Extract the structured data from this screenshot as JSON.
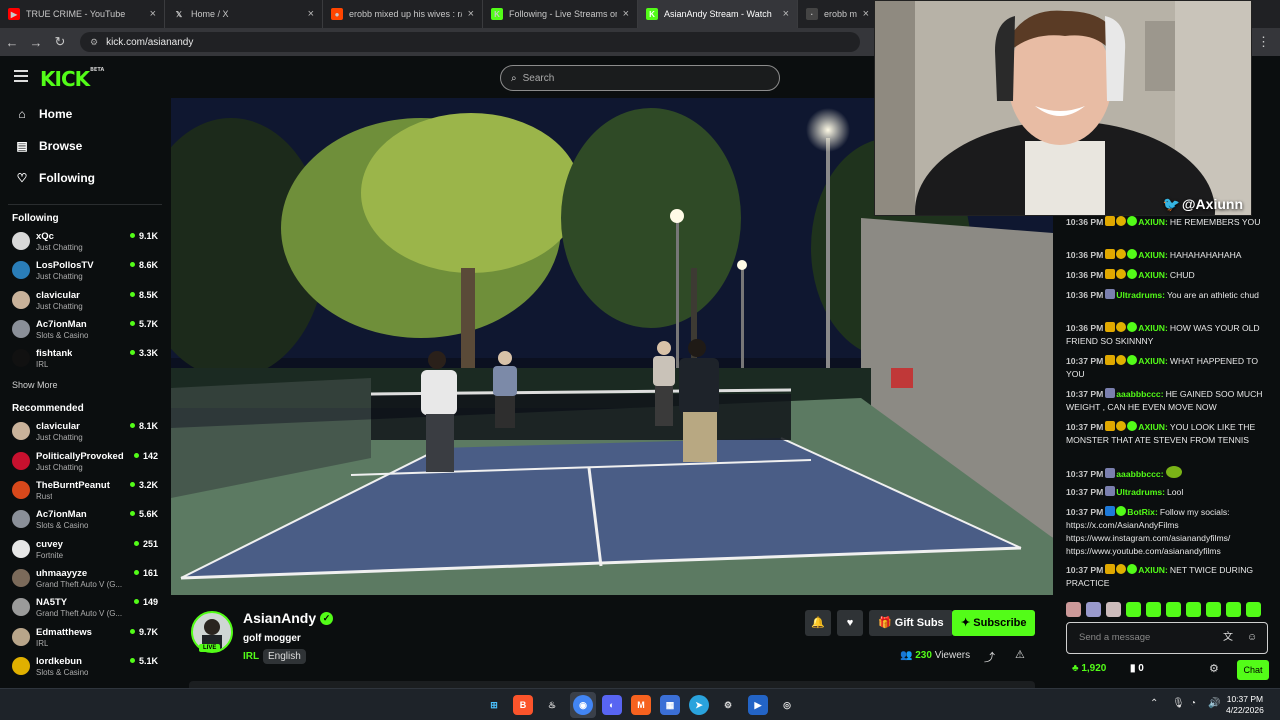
{
  "browser": {
    "tabs": [
      {
        "title": "TRUE CRIME - YouTube",
        "icon": "youtube-icon",
        "color": "#ff0000",
        "glyph": "▶",
        "active": false
      },
      {
        "title": "Home / X",
        "icon": "x-icon",
        "color": "#202124",
        "glyph": "𝕏",
        "active": false
      },
      {
        "title": "erobb mixed up his wives : r/Liv",
        "icon": "reddit-icon",
        "color": "#ff4500",
        "glyph": "●",
        "active": false
      },
      {
        "title": "Following - Live Streams on Kic",
        "icon": "kick-icon",
        "color": "#53fc18",
        "glyph": "K",
        "active": false
      },
      {
        "title": "AsianAndy Stream - Watch",
        "icon": "kick-icon",
        "color": "#53fc18",
        "glyph": "K",
        "active": true
      },
      {
        "title": "erobb mixed u",
        "icon": "page-icon",
        "color": "#444",
        "glyph": "·",
        "active": false
      }
    ],
    "url": "kick.com/asianandy"
  },
  "kick": {
    "logo": "KICK",
    "logo_tag": "BETA",
    "search_placeholder": "Search"
  },
  "sidebar": {
    "nav": [
      {
        "label": "Home",
        "icon": "home-icon",
        "glyph": "⌂"
      },
      {
        "label": "Browse",
        "icon": "browse-icon",
        "glyph": "▤"
      },
      {
        "label": "Following",
        "icon": "heart-icon",
        "glyph": "♡"
      }
    ],
    "following_title": "Following",
    "following": [
      {
        "name": "xQc",
        "category": "Just Chatting",
        "viewers": "9.1K",
        "avatar": "#d8d8d8"
      },
      {
        "name": "LosPollosTV",
        "category": "Just Chatting",
        "viewers": "8.6K",
        "avatar": "#2a7db8"
      },
      {
        "name": "clavicular",
        "category": "Just Chatting",
        "viewers": "8.5K",
        "avatar": "#c9b29a"
      },
      {
        "name": "Ac7ionMan",
        "category": "Slots & Casino",
        "viewers": "5.7K",
        "avatar": "#8a8f98"
      },
      {
        "name": "fishtank",
        "category": "IRL",
        "viewers": "3.3K",
        "avatar": "#111111"
      }
    ],
    "show_more": "Show More",
    "recommended_title": "Recommended",
    "recommended": [
      {
        "name": "clavicular",
        "category": "Just Chatting",
        "viewers": "8.1K",
        "avatar": "#c9b29a"
      },
      {
        "name": "PoliticallyProvoked",
        "category": "Just Chatting",
        "viewers": "142",
        "avatar": "#c8102e"
      },
      {
        "name": "TheBurntPeanut",
        "category": "Rust",
        "viewers": "3.2K",
        "avatar": "#d8481b"
      },
      {
        "name": "Ac7ionMan",
        "category": "Slots & Casino",
        "viewers": "5.6K",
        "avatar": "#8a8f98"
      },
      {
        "name": "cuvey",
        "category": "Fortnite",
        "viewers": "251",
        "avatar": "#e6e6e6"
      },
      {
        "name": "uhmaayyze",
        "category": "Grand Theft Auto V (G...",
        "viewers": "161",
        "avatar": "#7b6a5a"
      },
      {
        "name": "NA5TY",
        "category": "Grand Theft Auto V (G...",
        "viewers": "149",
        "avatar": "#9a9a9a"
      },
      {
        "name": "Edmatthews",
        "category": "IRL",
        "viewers": "9.7K",
        "avatar": "#b8a58a"
      },
      {
        "name": "lordkebun",
        "category": "Slots & Casino",
        "viewers": "5.1K",
        "avatar": "#e0b000"
      }
    ]
  },
  "webcam": {
    "handle": "@Axiunn"
  },
  "channel": {
    "name": "AsianAndy",
    "live_label": "LIVE",
    "title": "golf mogger",
    "category": "IRL",
    "language": "English",
    "gift_label": "Gift Subs",
    "subscribe_label": "Subscribe",
    "viewers_count": "230",
    "viewers_label": "Viewers"
  },
  "chat": {
    "messages": [
      {
        "time": "10:36 PM",
        "user": "AXIUN:",
        "color": "#53fc18",
        "badges": [
          "crown",
          "coin",
          "verified"
        ],
        "text": "HE REMEMBERS YOU"
      },
      {
        "time": "10:36 PM",
        "user": "AXIUN:",
        "color": "#53fc18",
        "badges": [
          "crown",
          "coin",
          "verified"
        ],
        "text": "HAHAHAHAHAHA"
      },
      {
        "time": "10:36 PM",
        "user": "AXIUN:",
        "color": "#53fc18",
        "badges": [
          "crown",
          "coin",
          "verified"
        ],
        "text": "CHUD"
      },
      {
        "time": "10:36 PM",
        "user": "Ultradrums:",
        "color": "#53fc18",
        "badges": [
          "sub"
        ],
        "text": "You are an athletic chud"
      },
      {
        "time": "10:36 PM",
        "user": "AXIUN:",
        "color": "#53fc18",
        "badges": [
          "crown",
          "coin",
          "verified"
        ],
        "text": "HOW WAS YOUR OLD FRIEND SO SKINNNY"
      },
      {
        "time": "10:37 PM",
        "user": "AXIUN:",
        "color": "#53fc18",
        "badges": [
          "crown",
          "coin",
          "verified"
        ],
        "text": "WHAT HAPPENED TO YOU"
      },
      {
        "time": "10:37 PM",
        "user": "aaabbbccc:",
        "color": "#53fc18",
        "badges": [
          "sub"
        ],
        "text": "HE GAINED SOO MUCH WEIGHT , CAN HE EVEN MOVE NOW"
      },
      {
        "time": "10:37 PM",
        "user": "AXIUN:",
        "color": "#53fc18",
        "badges": [
          "crown",
          "coin",
          "verified"
        ],
        "text": "YOU LOOK LIKE THE MONSTER THAT ATE STEVEN FROM TENNIS"
      },
      {
        "time": "10:37 PM",
        "user": "aaabbbccc:",
        "color": "#53fc18",
        "badges": [
          "sub"
        ],
        "text": ""
      },
      {
        "time": "10:37 PM",
        "user": "Ultradrums:",
        "color": "#53fc18",
        "badges": [
          "sub"
        ],
        "text": "Lool"
      },
      {
        "time": "10:37 PM",
        "user": "BotRix:",
        "color": "#53fc18",
        "badges": [
          "bot",
          "verified"
        ],
        "text": "Follow my socials: https://x.com/AsianAndyFilms https://www.instagram.com/asianandyfilms/ https://www.youtube.com/asianandyfilms"
      },
      {
        "time": "10:37 PM",
        "user": "AXIUN:",
        "color": "#53fc18",
        "badges": [
          "crown",
          "coin",
          "verified"
        ],
        "text": "NET TWICE DURING PRACTICE"
      }
    ],
    "input_placeholder": "Send a message",
    "points": "1,920",
    "zero": "0",
    "chat_button": "Chat"
  },
  "taskbar": {
    "time": "10:37 PM",
    "date": "4/22/2026"
  }
}
